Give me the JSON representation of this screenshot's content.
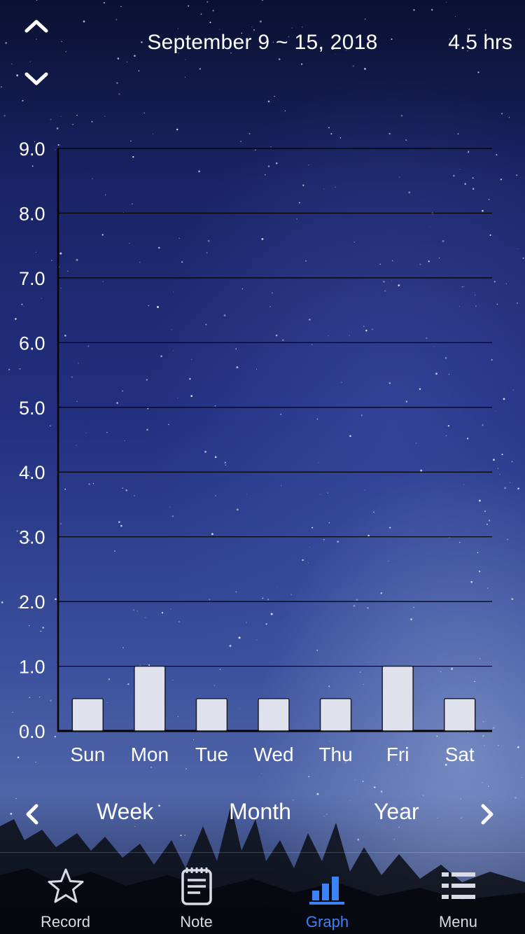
{
  "header": {
    "date_range": "September 9 ~ 15, 2018",
    "total": "4.5 hrs",
    "prev_icon": "chevron-up-icon",
    "next_icon": "chevron-down-icon"
  },
  "chart_data": {
    "type": "bar",
    "title": "",
    "xlabel": "",
    "ylabel": "",
    "categories": [
      "Sun",
      "Mon",
      "Tue",
      "Wed",
      "Thu",
      "Fri",
      "Sat"
    ],
    "values": [
      0.5,
      1.0,
      0.5,
      0.5,
      0.5,
      1.0,
      0.5
    ],
    "ylim": [
      0,
      9
    ],
    "yticks": [
      "0.0",
      "1.0",
      "2.0",
      "3.0",
      "4.0",
      "5.0",
      "6.0",
      "7.0",
      "8.0",
      "9.0"
    ],
    "grid": true,
    "bar_color": "#dfe2ec",
    "gridline_color": "#000000"
  },
  "period": {
    "tabs": [
      "Week",
      "Month",
      "Year"
    ],
    "prev_icon": "chevron-left-icon",
    "next_icon": "chevron-right-icon"
  },
  "tabbar": {
    "items": [
      {
        "label": "Record",
        "icon": "star-icon"
      },
      {
        "label": "Note",
        "icon": "note-icon"
      },
      {
        "label": "Graph",
        "icon": "bar-chart-icon"
      },
      {
        "label": "Menu",
        "icon": "menu-icon"
      }
    ],
    "active_index": 2,
    "active_color": "#3b82f6"
  }
}
